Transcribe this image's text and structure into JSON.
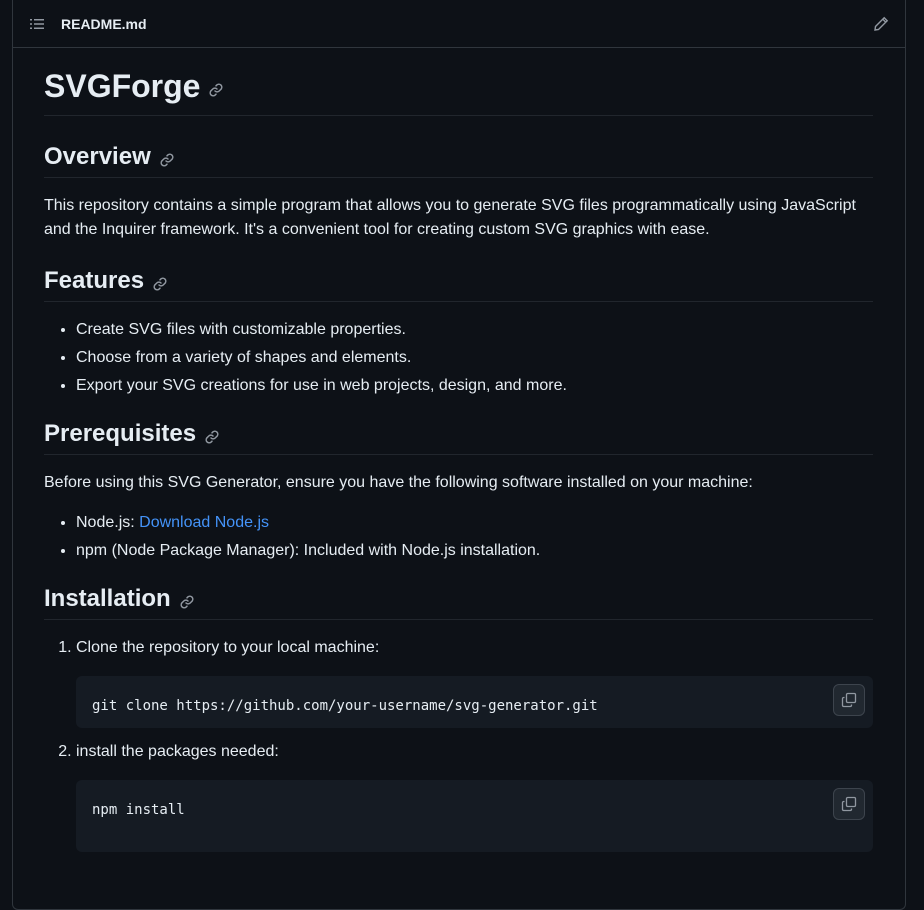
{
  "header": {
    "file_name": "README.md"
  },
  "readme": {
    "title": "SVGForge",
    "overview": {
      "heading": "Overview",
      "text": "This repository contains a simple program that allows you to generate SVG files programmatically using JavaScript and the Inquirer framework. It's a convenient tool for creating custom SVG graphics with ease."
    },
    "features": {
      "heading": "Features",
      "items": [
        "Create SVG files with customizable properties.",
        "Choose from a variety of shapes and elements.",
        "Export your SVG creations for use in web projects, design, and more."
      ]
    },
    "prerequisites": {
      "heading": "Prerequisites",
      "intro": "Before using this SVG Generator, ensure you have the following software installed on your machine:",
      "node_label": "Node.js: ",
      "node_link": "Download Node.js",
      "npm_text": "npm (Node Package Manager): Included with Node.js installation."
    },
    "installation": {
      "heading": "Installation",
      "steps": [
        {
          "text": "Clone the repository to your local machine:",
          "code": "git clone https://github.com/your-username/svg-generator.git"
        },
        {
          "text": "install the packages needed:",
          "code": "npm install"
        }
      ]
    }
  },
  "icons": {
    "toc": "list-unordered-icon",
    "edit": "pencil-icon",
    "anchor": "link-icon",
    "copy": "copy-icon"
  },
  "colors": {
    "background": "#0d1117",
    "border": "#30363d",
    "text": "#e6edf3",
    "muted": "#9198a1",
    "link": "#4493f8",
    "code_bg": "#151b23"
  }
}
